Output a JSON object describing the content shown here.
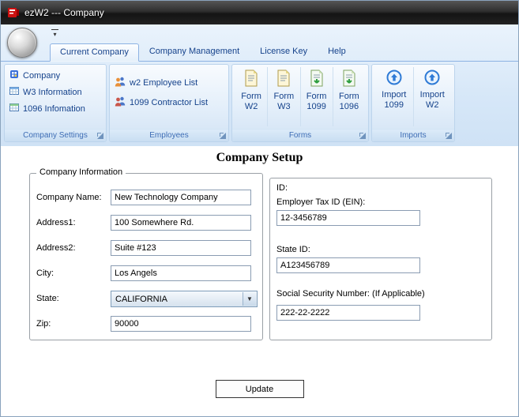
{
  "window": {
    "title": "ezW2 --- Company"
  },
  "tabs": {
    "current_company": "Current Company",
    "company_management": "Company Management",
    "license_key": "License Key",
    "help": "Help"
  },
  "ribbon": {
    "groups": {
      "company_settings": {
        "label": "Company Settings",
        "items": [
          {
            "label": "Company"
          },
          {
            "label": "W3 Information"
          },
          {
            "label": "1096 Infomation"
          }
        ]
      },
      "employees": {
        "label": "Employees",
        "items": [
          {
            "label": "w2 Employee List"
          },
          {
            "label": "1099 Contractor List"
          }
        ]
      },
      "forms": {
        "label": "Forms",
        "items": [
          {
            "line1": "Form",
            "line2": "W2"
          },
          {
            "line1": "Form",
            "line2": "W3"
          },
          {
            "line1": "Form",
            "line2": "1099"
          },
          {
            "line1": "Form",
            "line2": "1096"
          }
        ]
      },
      "imports": {
        "label": "Imports",
        "items": [
          {
            "line1": "Import",
            "line2": "1099"
          },
          {
            "line1": "Import",
            "line2": "W2"
          }
        ]
      }
    }
  },
  "main": {
    "title": "Company Setup",
    "company_info": {
      "legend": "Company Information",
      "fields": [
        {
          "label": "Company Name:",
          "value": "New Technology Company"
        },
        {
          "label": "Address1:",
          "value": "100 Somewhere Rd."
        },
        {
          "label": "Address2:",
          "value": "Suite #123"
        },
        {
          "label": "City:",
          "value": "Los Angels"
        },
        {
          "label": "State:",
          "value": "CALIFORNIA"
        },
        {
          "label": "Zip:",
          "value": "90000"
        }
      ]
    },
    "id_section": {
      "heading": "ID:",
      "fields": [
        {
          "label": "Employer Tax ID (EIN):",
          "value": "12-3456789"
        },
        {
          "label": "State ID:",
          "value": "A123456789"
        },
        {
          "label": "Social Security Number: (If Applicable)",
          "value": "222-22-2222"
        }
      ]
    },
    "update_button": "Update"
  }
}
